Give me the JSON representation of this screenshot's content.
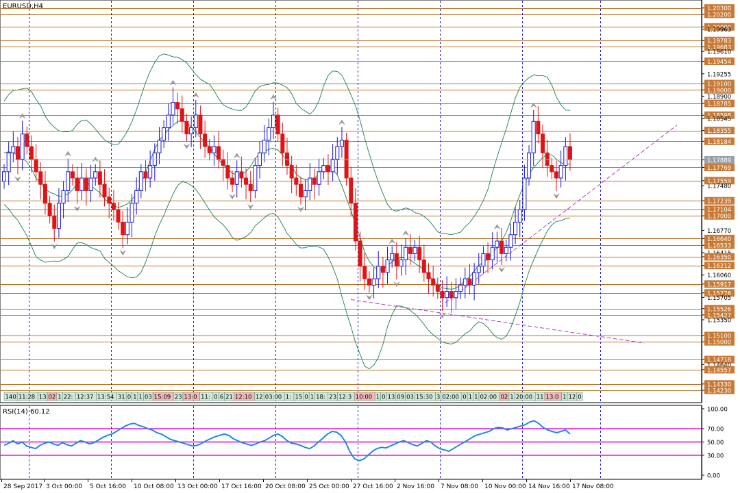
{
  "window": {
    "symbol_title": "EURUSD,H4"
  },
  "price_axis": {
    "ticks": [
      "1.20300",
      "1.20200",
      "1.20000",
      "1.19963",
      "1.19783",
      "1.19683",
      "1.19610",
      "1.19454",
      "1.19255",
      "1.19100",
      "1.19000",
      "1.18900",
      "1.18785",
      "1.18598",
      "1.18545",
      "1.18355",
      "1.18184",
      "1.17889",
      "1.17769",
      "1.17559",
      "1.17480",
      "1.17239",
      "1.17104",
      "1.17000",
      "1.16770",
      "1.16640",
      "1.16533",
      "1.16415",
      "1.16350",
      "1.16212",
      "1.16060",
      "1.15917",
      "1.15776",
      "1.15705",
      "1.15526",
      "1.15427",
      "1.15350",
      "1.15100",
      "1.15000",
      "1.14718",
      "1.14640",
      "1.14557",
      "1.14330",
      "1.14230"
    ],
    "highlighted_ticks": [
      "1.20300",
      "1.20200",
      "1.20000",
      "1.19783",
      "1.19683",
      "1.19454",
      "1.19100",
      "1.19000",
      "1.18785",
      "1.18598",
      "1.18355",
      "1.18184",
      "1.17769",
      "1.17559",
      "1.17239",
      "1.17104",
      "1.17000",
      "1.16640",
      "1.16533",
      "1.16350",
      "1.16212",
      "1.15917",
      "1.15776",
      "1.15526",
      "1.15427",
      "1.15100",
      "1.15000",
      "1.14718",
      "1.14557",
      "1.14330",
      "1.14230"
    ],
    "current_price": "1.17889"
  },
  "session_strip": {
    "labels": [
      "140",
      "11:28",
      "13",
      "02",
      "1",
      "22:",
      "12:37",
      "13:54",
      "31",
      "0",
      "1",
      "1",
      "03",
      "15:09",
      "23",
      "13:0",
      "11:",
      "0",
      "6",
      "21",
      "12:10",
      "12",
      "03:00",
      "1:",
      "15",
      "0",
      "1",
      "18:",
      "23",
      "12:3",
      "10:00",
      "1",
      "0",
      "13",
      "09",
      "03",
      "15:30",
      "3",
      "02:00",
      "0",
      "1",
      "1",
      "02:00",
      "02",
      "1",
      "20:00",
      "11",
      "13:0",
      "1",
      "12",
      "0",
      "12:57",
      "15:00"
    ],
    "red_labels": [
      "15:09",
      "13:0",
      "12:10",
      "10:00",
      "02",
      "12:57"
    ]
  },
  "rsi_panel": {
    "title": "RSI(14) 60.12",
    "levels": [
      "100.00",
      "70.00",
      "50.00",
      "30.00",
      "0.00"
    ]
  },
  "time_axis": {
    "labels": [
      "28 Sep 2017",
      "3 Oct 00:00",
      "5 Oct 16:00",
      "10 Oct 08:00",
      "13 Oct 00:00",
      "17 Oct 16:00",
      "20 Oct 08:00",
      "25 Oct 00:00",
      "27 Oct 16:00",
      "2 Nov 16:00",
      "7 Nov 08:00",
      "10 Nov 00:00",
      "14 Nov 16:00",
      "17 Nov 08:00"
    ]
  },
  "chart_data": {
    "type": "candlestick",
    "title": "EURUSD,H4",
    "ylim": [
      1.1423,
      1.2034
    ],
    "current_price": 1.17889,
    "horizontal_levels": [
      1.203,
      1.202,
      1.2,
      1.19783,
      1.19683,
      1.19454,
      1.191,
      1.19,
      1.18785,
      1.18598,
      1.18355,
      1.18184,
      1.17769,
      1.17559,
      1.17239,
      1.17104,
      1.17,
      1.1664,
      1.16533,
      1.1635,
      1.16212,
      1.15917,
      1.15776,
      1.15526,
      1.15427,
      1.151,
      1.15,
      1.14718,
      1.14557,
      1.1433,
      1.1423
    ],
    "close_path": [
      1.177,
      1.18,
      1.181,
      1.179,
      1.183,
      1.181,
      1.179,
      1.177,
      1.175,
      1.172,
      1.17,
      1.168,
      1.172,
      1.174,
      1.177,
      1.176,
      1.174,
      1.176,
      1.174,
      1.176,
      1.177,
      1.175,
      1.173,
      1.172,
      1.171,
      1.169,
      1.167,
      1.169,
      1.172,
      1.174,
      1.177,
      1.176,
      1.178,
      1.18,
      1.182,
      1.184,
      1.186,
      1.188,
      1.187,
      1.185,
      1.183,
      1.184,
      1.186,
      1.183,
      1.181,
      1.18,
      1.181,
      1.179,
      1.178,
      1.176,
      1.175,
      1.177,
      1.176,
      1.175,
      1.174,
      1.178,
      1.18,
      1.182,
      1.184,
      1.186,
      1.183,
      1.18,
      1.178,
      1.176,
      1.175,
      1.173,
      1.174,
      1.176,
      1.175,
      1.177,
      1.178,
      1.177,
      1.179,
      1.181,
      1.182,
      1.176,
      1.172,
      1.166,
      1.162,
      1.16,
      1.159,
      1.16,
      1.162,
      1.161,
      1.163,
      1.164,
      1.162,
      1.163,
      1.165,
      1.164,
      1.165,
      1.163,
      1.161,
      1.16,
      1.159,
      1.158,
      1.157,
      1.158,
      1.157,
      1.158,
      1.159,
      1.16,
      1.159,
      1.161,
      1.162,
      1.164,
      1.163,
      1.165,
      1.166,
      1.164,
      1.165,
      1.167,
      1.169,
      1.171,
      1.176,
      1.18,
      1.185,
      1.183,
      1.18,
      1.178,
      1.177,
      1.176,
      1.178,
      1.181,
      1.179
    ],
    "moving_average_lines": 3,
    "trendlines": [
      {
        "from": "27 Oct 16:00",
        "to": "17 Nov 08:00",
        "direction": "down"
      },
      {
        "from": "3 Nov",
        "to": "17 Nov",
        "direction": "up"
      }
    ],
    "rsi": {
      "period": 14,
      "latest": 60.12,
      "levels": [
        70,
        50,
        30
      ],
      "ylim": [
        0,
        100
      ],
      "values": [
        45,
        48,
        52,
        47,
        50,
        44,
        42,
        40,
        45,
        48,
        50,
        47,
        45,
        49,
        46,
        44,
        48,
        52,
        50,
        47,
        49,
        53,
        57,
        60,
        62,
        66,
        70,
        74,
        77,
        78,
        75,
        73,
        70,
        68,
        64,
        62,
        58,
        54,
        52,
        50,
        48,
        46,
        44,
        45,
        48,
        52,
        55,
        58,
        60,
        62,
        60,
        55,
        52,
        49,
        47,
        45,
        47,
        50,
        52,
        56,
        60,
        62,
        58,
        52,
        48,
        47,
        45,
        42,
        40,
        44,
        50,
        56,
        62,
        66,
        65,
        60,
        50,
        35,
        25,
        22,
        24,
        30,
        36,
        40,
        42,
        41,
        44,
        47,
        50,
        52,
        49,
        46,
        44,
        48,
        52,
        50,
        44,
        40,
        38,
        36,
        40,
        44,
        48,
        52,
        56,
        60,
        62,
        64,
        66,
        70,
        72,
        71,
        68,
        70,
        72,
        74,
        76,
        80,
        82,
        78,
        72,
        68,
        66,
        64,
        66,
        68,
        62
      ]
    }
  }
}
